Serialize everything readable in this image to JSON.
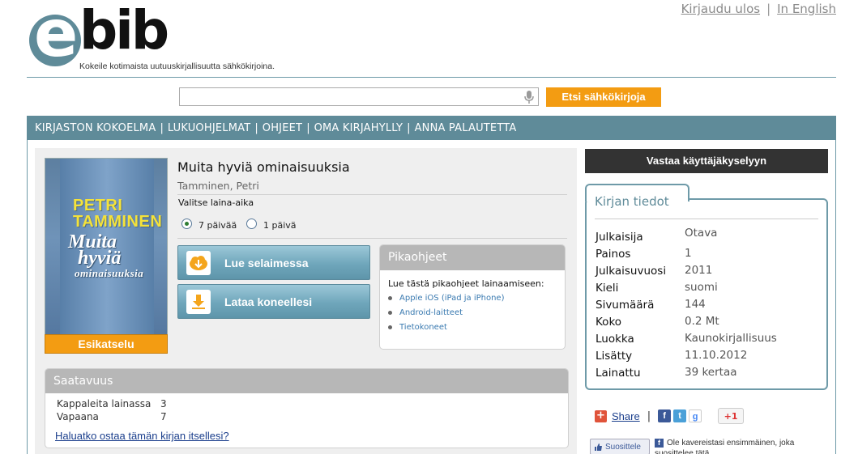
{
  "header": {
    "logout_label": "Kirjaudu ulos",
    "separator": "|",
    "english_label": "In English",
    "logo_e": "e",
    "logo_bib": "bib",
    "tagline": "Kokeile kotimaista uutuuskirjallisuutta sähkökirjoina."
  },
  "search": {
    "placeholder": "",
    "button_label": "Etsi sähkökirjoja"
  },
  "nav": {
    "items": [
      "KIRJASTON KOKOELMA",
      "LUKUOHJELMAT",
      "OHJEET",
      "OMA KIRJAHYLLY",
      "ANNA PALAUTETTA"
    ],
    "separator": "|"
  },
  "book": {
    "cover_author": "PETRI\nTAMMINEN",
    "cover_title_1": "Muita",
    "cover_title_2": "hyviä",
    "cover_title_3": "ominaisuuksia",
    "preview_label": "Esikatselu",
    "title": "Muita hyviä ominaisuuksia",
    "author": "Tamminen, Petri",
    "loan_period_label": "Valitse laina-aika",
    "loan_options": [
      {
        "label": "7 päivää",
        "selected": true
      },
      {
        "label": "1 päivä",
        "selected": false
      }
    ],
    "read_in_browser_label": "Lue selaimessa",
    "download_label": "Lataa koneellesi"
  },
  "quick_guide": {
    "heading": "Pikaohjeet",
    "intro": "Lue tästä pikaohjeet lainaamiseen:",
    "links": [
      "Apple iOS (iPad ja iPhone)",
      "Android-laitteet",
      "Tietokoneet"
    ]
  },
  "availability": {
    "heading": "Saatavuus",
    "copies_label": "Kappaleita lainassa",
    "copies_value": "3",
    "free_label": "Vapaana",
    "free_value": "7",
    "buy_link": "Haluatko ostaa tämän kirjan itsellesi?"
  },
  "survey": {
    "button_label": "Vastaa käyttäjäkyselyyn"
  },
  "book_info": {
    "heading": "Kirjan tiedot",
    "rows": [
      {
        "key": "Julkaisija",
        "value": "Otava"
      },
      {
        "key": "Painos",
        "value": "1"
      },
      {
        "key": "Julkaisuvuosi",
        "value": "2011"
      },
      {
        "key": "Kieli",
        "value": "suomi"
      },
      {
        "key": "Sivumäärä",
        "value": "144"
      },
      {
        "key": "Koko",
        "value": "0.2 Mt"
      },
      {
        "key": "Luokka",
        "value": "Kaunokirjallisuus"
      },
      {
        "key": "Lisätty",
        "value": "11.10.2012"
      },
      {
        "key": "Lainattu",
        "value": "39 kertaa"
      }
    ]
  },
  "social": {
    "share_label": "Share",
    "separator": "|",
    "gplus_label": "+1",
    "like_label": "Suosittele",
    "like_text": "Ole kavereistasi ensimmäinen, joka suosittelee tätä."
  },
  "colors": {
    "accent_teal": "#5f8b99",
    "accent_orange": "#f39c12"
  }
}
